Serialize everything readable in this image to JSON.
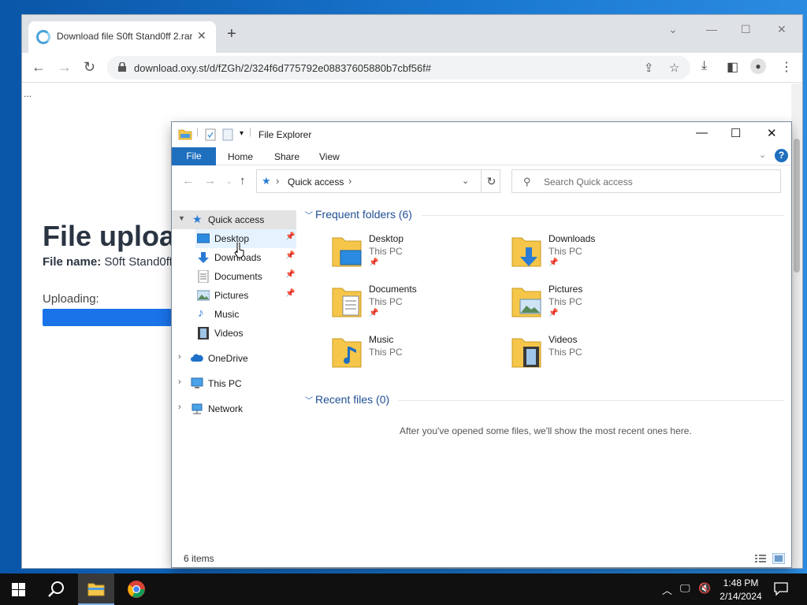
{
  "browser": {
    "tab_title": "Download file S0ft Stand0ff 2.rar",
    "url": "download.oxy.st/d/fZGh/2/324f6d775792e08837605880b7cbf56f#",
    "page": {
      "ellipsis": "...",
      "heading": "File uploa",
      "filename_label": "File name:",
      "filename_value": "S0ft Stand0ff",
      "uploading": "Uploading:"
    }
  },
  "explorer": {
    "title": "File Explorer",
    "ribbon_tabs": [
      "File",
      "Home",
      "Share",
      "View"
    ],
    "address": "Quick access",
    "search_placeholder": "Search Quick access",
    "nav_items": [
      {
        "label": "Quick access",
        "icon": "star-icon"
      },
      {
        "label": "Desktop",
        "icon": "desktop-icon",
        "pinned": true
      },
      {
        "label": "Downloads",
        "icon": "download-arrow-icon",
        "pinned": true
      },
      {
        "label": "Documents",
        "icon": "document-icon",
        "pinned": true
      },
      {
        "label": "Pictures",
        "icon": "picture-icon",
        "pinned": true
      },
      {
        "label": "Music",
        "icon": "music-note-icon"
      },
      {
        "label": "Videos",
        "icon": "film-icon"
      },
      {
        "label": "OneDrive",
        "icon": "cloud-icon"
      },
      {
        "label": "This PC",
        "icon": "computer-icon"
      },
      {
        "label": "Network",
        "icon": "network-icon"
      }
    ],
    "frequent_header": "Frequent folders (6)",
    "folders": [
      {
        "name": "Desktop",
        "location": "This PC",
        "pinned": true
      },
      {
        "name": "Downloads",
        "location": "This PC",
        "pinned": true
      },
      {
        "name": "Documents",
        "location": "This PC",
        "pinned": true
      },
      {
        "name": "Pictures",
        "location": "This PC",
        "pinned": true
      },
      {
        "name": "Music",
        "location": "This PC",
        "pinned": false
      },
      {
        "name": "Videos",
        "location": "This PC",
        "pinned": false
      }
    ],
    "recent_header": "Recent files (0)",
    "recent_empty": "After you've opened some files, we'll show the most recent ones here.",
    "status": "6 items"
  },
  "taskbar": {
    "time": "1:48 PM",
    "date": "2/14/2024"
  },
  "colors": {
    "accent": "#1f6fbf",
    "progress": "#1a73e8",
    "folder_yellow": "#f5c64a"
  }
}
